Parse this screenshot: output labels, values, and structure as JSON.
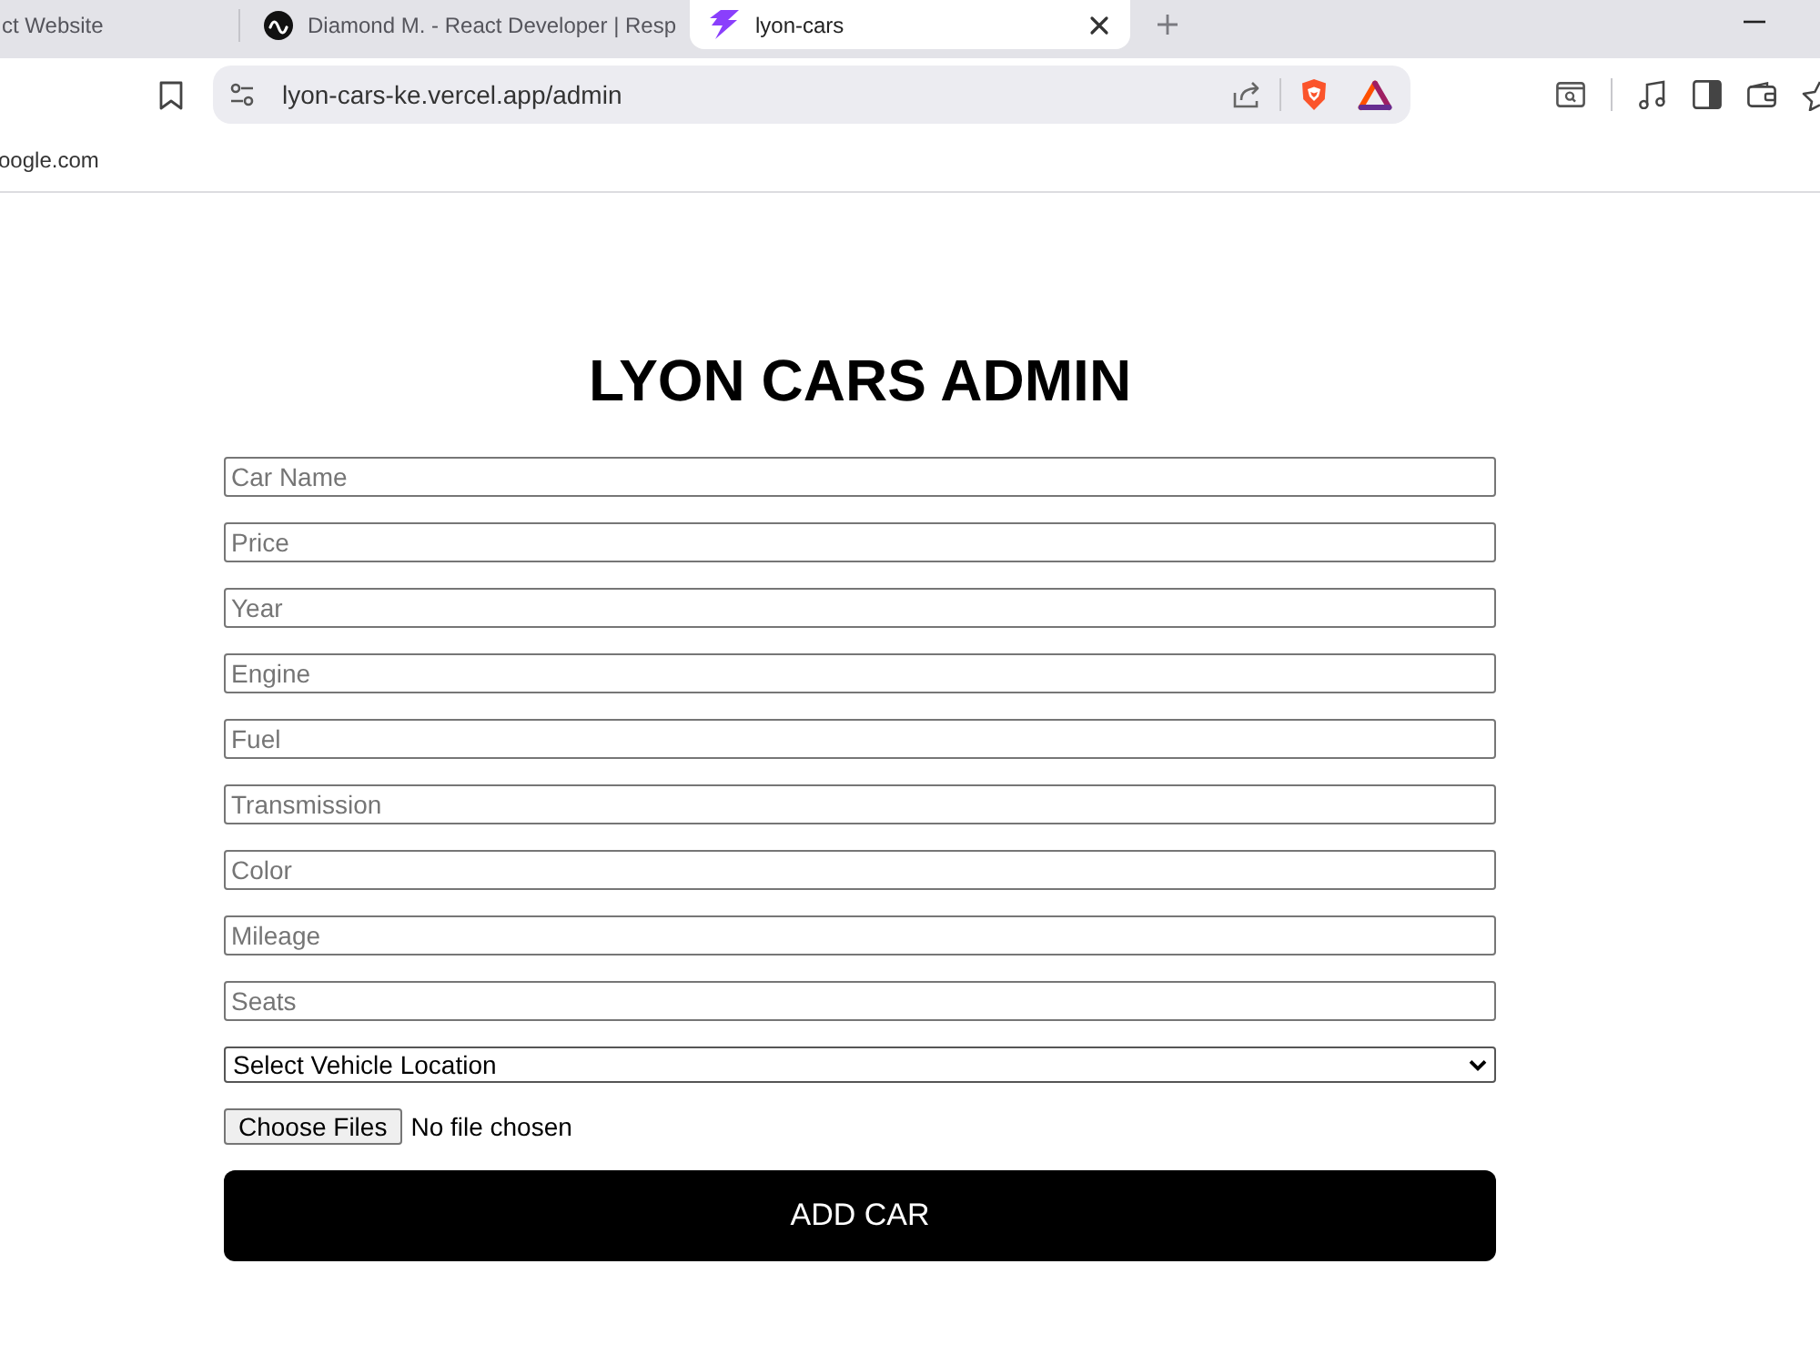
{
  "browser": {
    "tabs": [
      {
        "title": "ct Website",
        "selected": false
      },
      {
        "title": "Diamond M. - React Developer | Resp",
        "selected": false
      },
      {
        "title": "lyon-cars",
        "selected": true
      }
    ],
    "address_bar": {
      "url": "lyon-cars-ke.vercel.app/admin"
    },
    "bookmarks": [
      {
        "label": "oogle.com"
      }
    ]
  },
  "page": {
    "title": "LYON CARS ADMIN",
    "fields": [
      {
        "placeholder": "Car Name"
      },
      {
        "placeholder": "Price"
      },
      {
        "placeholder": "Year"
      },
      {
        "placeholder": "Engine"
      },
      {
        "placeholder": "Fuel"
      },
      {
        "placeholder": "Transmission"
      },
      {
        "placeholder": "Color"
      },
      {
        "placeholder": "Mileage"
      },
      {
        "placeholder": "Seats"
      }
    ],
    "location_select": {
      "value": "Select Vehicle Location"
    },
    "file_input": {
      "button": "Choose Files",
      "status": "No file chosen"
    },
    "submit_button": "ADD CAR"
  }
}
